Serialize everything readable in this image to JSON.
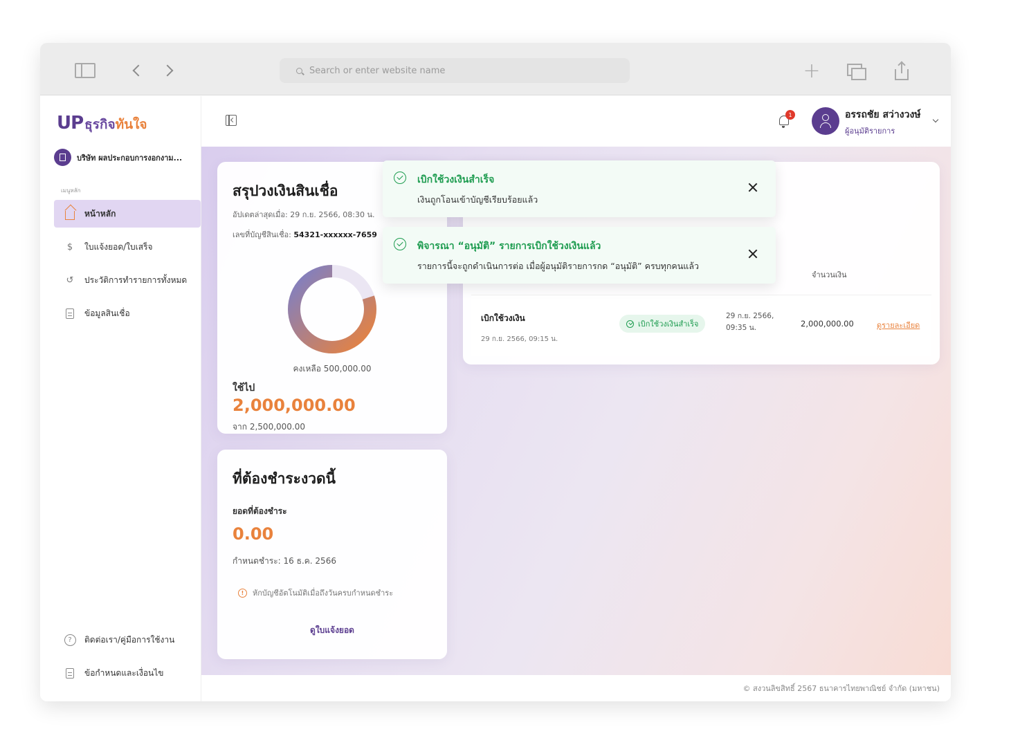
{
  "browser": {
    "address_placeholder": "Search or enter website name"
  },
  "brand": {
    "logo_up": "UP",
    "logo_text_1": "ธุรกิจ",
    "logo_text_2": "ทันใจ",
    "company_name": "บริษัท ผลประกอบการงอกงาม..."
  },
  "sidebar": {
    "menu_heading": "เมนูหลัก",
    "items": [
      {
        "label": "หน้าหลัก",
        "icon": "home-icon",
        "active": true
      },
      {
        "label": "ใบแจ้งยอด/ใบเสร็จ",
        "icon": "invoice-icon",
        "active": false
      },
      {
        "label": "ประวัติการทำรายการทั้งหมด",
        "icon": "history-icon",
        "active": false
      },
      {
        "label": "ข้อมูลสินเชื่อ",
        "icon": "document-icon",
        "active": false
      }
    ],
    "bottom_items": [
      {
        "label": "ติดต่อเรา/คู่มือการใช้งาน",
        "icon": "help-icon"
      },
      {
        "label": "ข้อกำหนดและเงื่อนไข",
        "icon": "document-icon"
      }
    ]
  },
  "header": {
    "notification_count": "1",
    "user_name": "อรรถชัย สว่างวงษ์",
    "user_role": "ผู้อนุมัติรายการ"
  },
  "summary": {
    "title": "สรุปวงเงินสินเชื่อ",
    "updated": "อัปเดตล่าสุดเมื่อ: 29 ก.ย. 2566, 08:30 น.",
    "account_label": "เลขที่บัญชีสินเชื่อ: ",
    "account_number": "54321-xxxxxx-7659",
    "remaining": "คงเหลือ 500,000.00",
    "used_label": "ใช้ไป",
    "used_amount": "2,000,000.00",
    "of_total": "จาก 2,500,000.00",
    "used_fraction": 0.8,
    "colors": {
      "used_start": "#e9823c",
      "used_end": "#7b7fc8",
      "remaining": "#ebe6f3"
    }
  },
  "due": {
    "title": "ที่ต้องชำระงวดนี้",
    "amount_label": "ยอดที่ต้องชำระ",
    "amount": "0.00",
    "due_date": "กำหนดชำระ: 16 ธ.ค. 2566",
    "note": "หักบัญชีอัตโนมัติเมื่อถึงวันครบกำหนดชำระ",
    "link": "ดูใบแจ้งยอด"
  },
  "transactions": {
    "amount_header": "จำนวนเงิน",
    "rows": [
      {
        "type": "เบิกใช้วงเงิน",
        "date": "29 ก.ย. 2566, 09:15 น.",
        "status": "เบิกใช้วงเงินสำเร็จ",
        "when_1": "29 ก.ย. 2566,",
        "when_2": "09:35 น.",
        "amount": "2,000,000.00",
        "link": "ดูรายละเอียด"
      }
    ]
  },
  "toasts": [
    {
      "title": "เบิกใช้วงเงินสำเร็จ",
      "message": "เงินถูกโอนเข้าบัญชีเรียบร้อยแล้ว"
    },
    {
      "title": "พิจารณา “อนุมัติ” รายการเบิกใช้วงเงินแล้ว",
      "message": "รายการนี้จะถูกดำเนินการต่อ เมื่อผู้อนุมัติรายการกด “อนุมัติ” ครบทุกคนแล้ว"
    }
  ],
  "footer": {
    "copyright": "© สงวนลิขสิทธิ์ 2567 ธนาคารไทยพาณิชย์ จำกัด (มหาชน)"
  }
}
